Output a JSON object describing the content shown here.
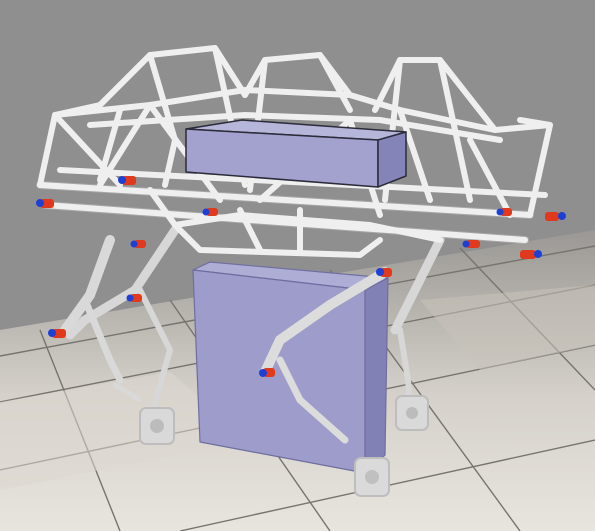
{
  "scene": {
    "kind": "3d-physics-simulation-view",
    "colors": {
      "sky": "#8f8f8f",
      "floor_light": "#e6e2dc",
      "floor_dark": "#cdc7bd",
      "grout": "#7a7672",
      "frame_tube": "#f2f2f2",
      "frame_shade": "#c9c9c9",
      "box_face": "#9a99c7",
      "box_side": "#7c7bb0",
      "box_top": "#b3b2d8",
      "actuator_red": "#e0391b",
      "actuator_blue": "#1c3fd6",
      "leg_metal": "#dadada"
    },
    "objects": [
      "floor-tiles",
      "roll-cage-frame",
      "payload-box-top",
      "payload-box-front",
      "leg-front-left",
      "leg-front-right",
      "leg-back-left",
      "leg-back-right",
      "actuators"
    ]
  }
}
